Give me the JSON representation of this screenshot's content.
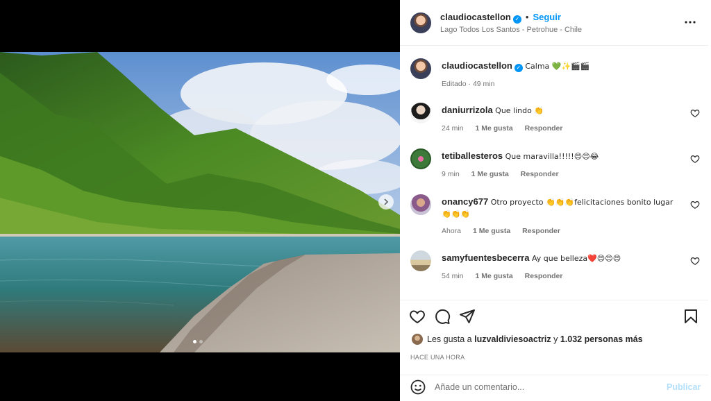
{
  "post": {
    "username": "claudiocastellon",
    "separator": "•",
    "follow_label": "Seguir",
    "location": "Lago Todos Los Santos - Petrohue - Chile",
    "more_label": "•••",
    "caption": "Calma 💚✨🎬🎬",
    "caption_meta": "Editado · 49 min",
    "carousel": {
      "slide_count": 2,
      "active_slide": 1
    }
  },
  "comments": [
    {
      "username": "daniurrizola",
      "text": "Que lindo 👏",
      "time": "24 min",
      "likes": "1 Me gusta",
      "reply": "Responder"
    },
    {
      "username": "tetiballesteros",
      "text": "Que maravilla!!!!!😍😍😂",
      "time": "9 min",
      "likes": "1 Me gusta",
      "reply": "Responder"
    },
    {
      "username": "onancy677",
      "text": "Otro proyecto 👏👏👏felicitaciones bonito lugar 👏👏👏",
      "time": "Ahora",
      "likes": "1 Me gusta",
      "reply": "Responder"
    },
    {
      "username": "samyfuentesbecerra",
      "text": "Ay que belleza❤️😍😍😍",
      "time": "54 min",
      "likes": "1 Me gusta",
      "reply": "Responder"
    }
  ],
  "likes": {
    "prefix": "Les gusta a",
    "user": "luzvaldiviesoactriz",
    "connector": "y",
    "count_text": "1.032 personas más"
  },
  "timestamp": "HACE UNA HORA",
  "composer": {
    "placeholder": "Añade un comentario...",
    "publish_label": "Publicar"
  },
  "colors": {
    "accent": "#0095f6",
    "publish_disabled": "#b2dffc",
    "meta_text": "#737373"
  }
}
